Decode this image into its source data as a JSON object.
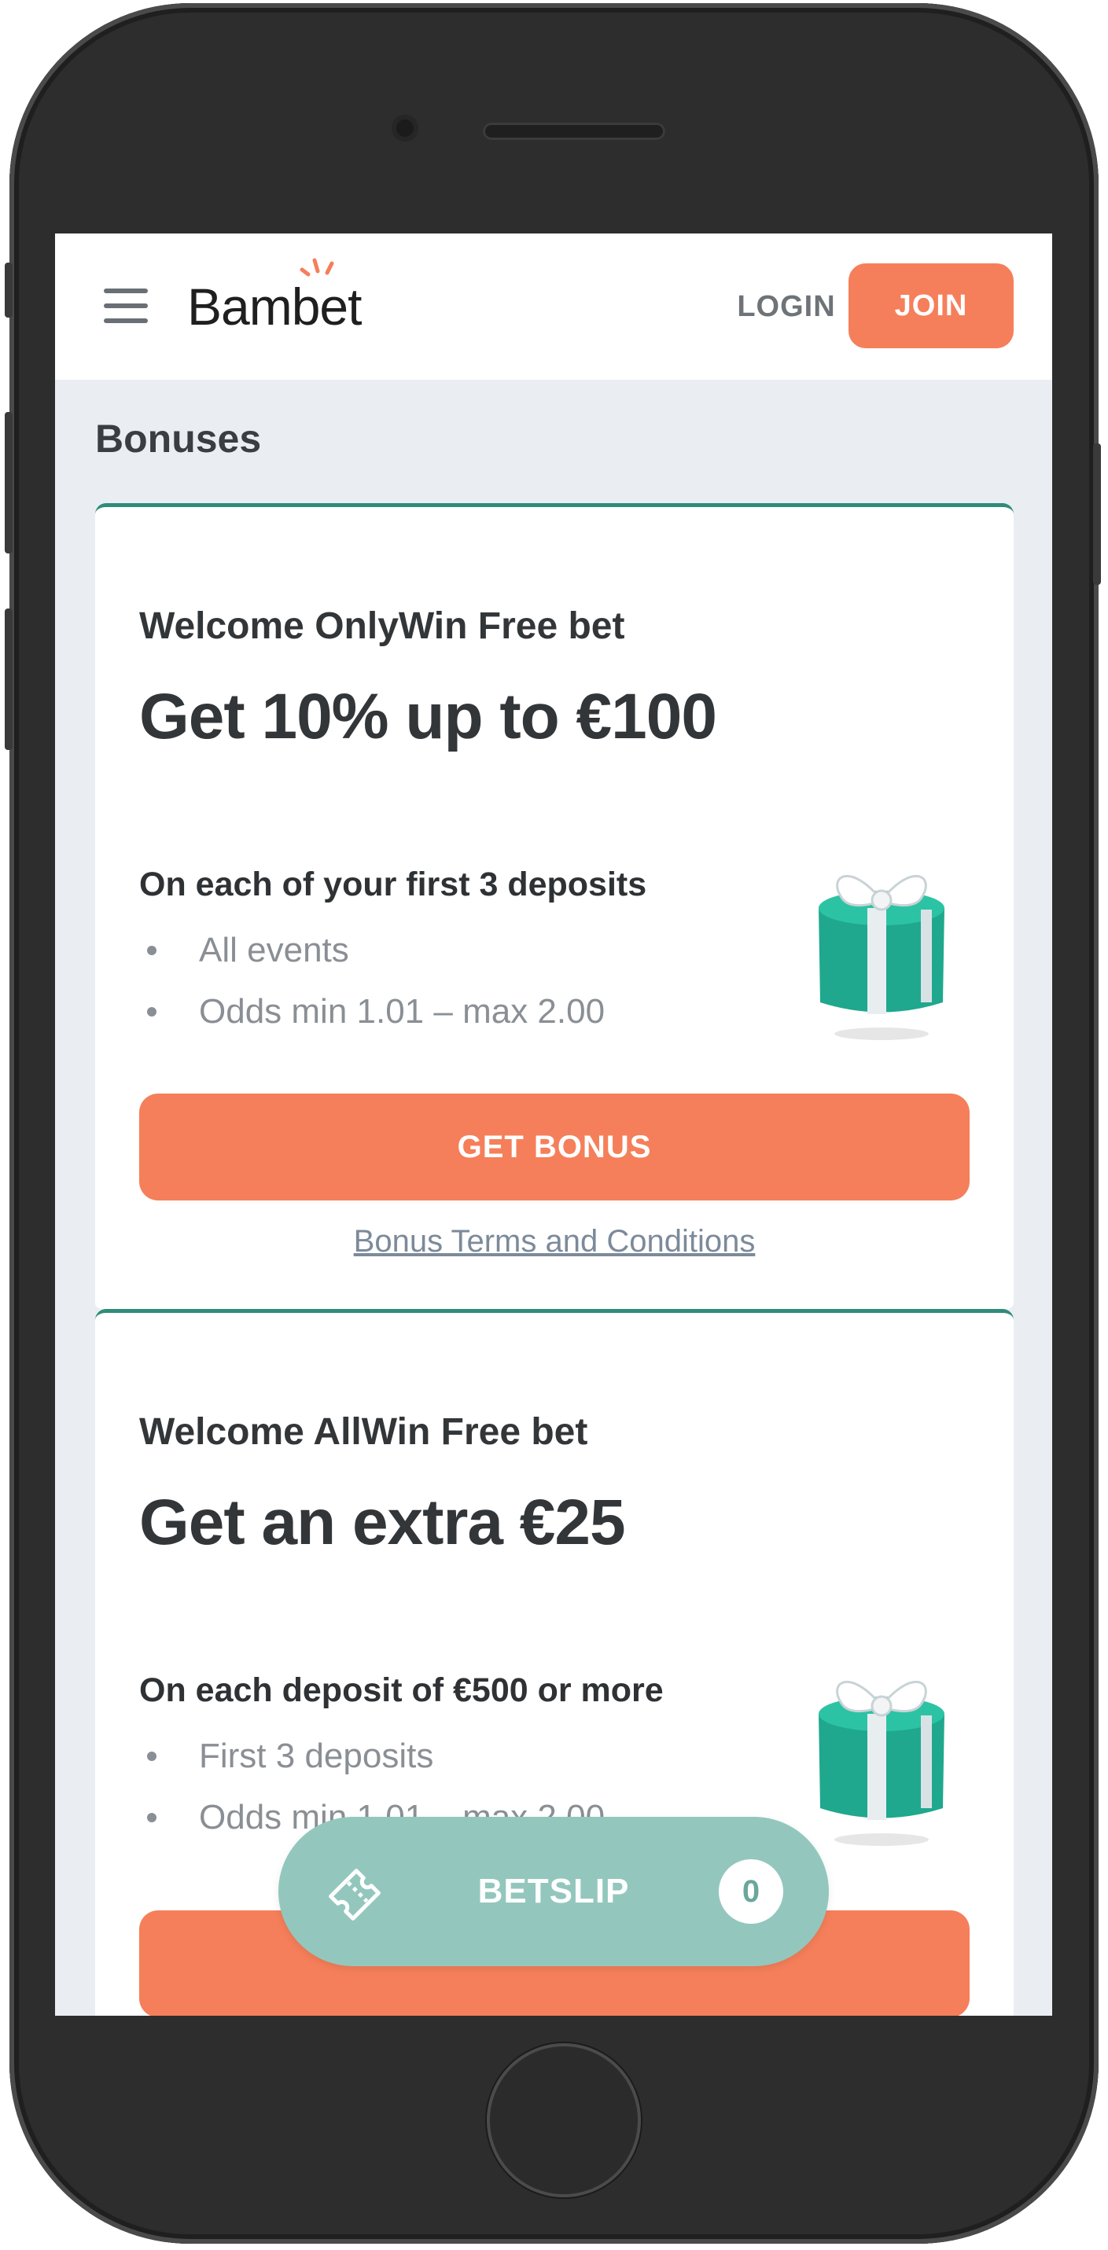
{
  "header": {
    "logo_text": "Bambet",
    "login_label": "LOGIN",
    "join_label": "JOIN"
  },
  "page": {
    "title": "Bonuses"
  },
  "bonuses": [
    {
      "subtitle": "Welcome OnlyWin Free bet",
      "headline": "Get 10% up to €100",
      "lead": "On each of your first 3 deposits",
      "bullets": [
        "All events",
        "Odds min 1.01 – max 2.00"
      ],
      "cta_label": "GET BONUS",
      "terms_label": "Bonus Terms and Conditions"
    },
    {
      "subtitle": "Welcome AllWin Free bet",
      "headline": "Get an extra €25",
      "lead": "On each deposit of €500 or more",
      "bullets": [
        "First 3 deposits",
        "Odds min 1.01 – max 2.00"
      ]
    }
  ],
  "betslip": {
    "label": "BETSLIP",
    "count": "0"
  },
  "colors": {
    "accent": "#f57f5a",
    "card_border": "#2f8c7b",
    "betslip_bg": "#93c7bd",
    "page_bg": "#eaeef2"
  },
  "icons": {
    "menu": "hamburger-icon",
    "gift": "gift-box-icon",
    "betslip": "ticket-icon"
  }
}
